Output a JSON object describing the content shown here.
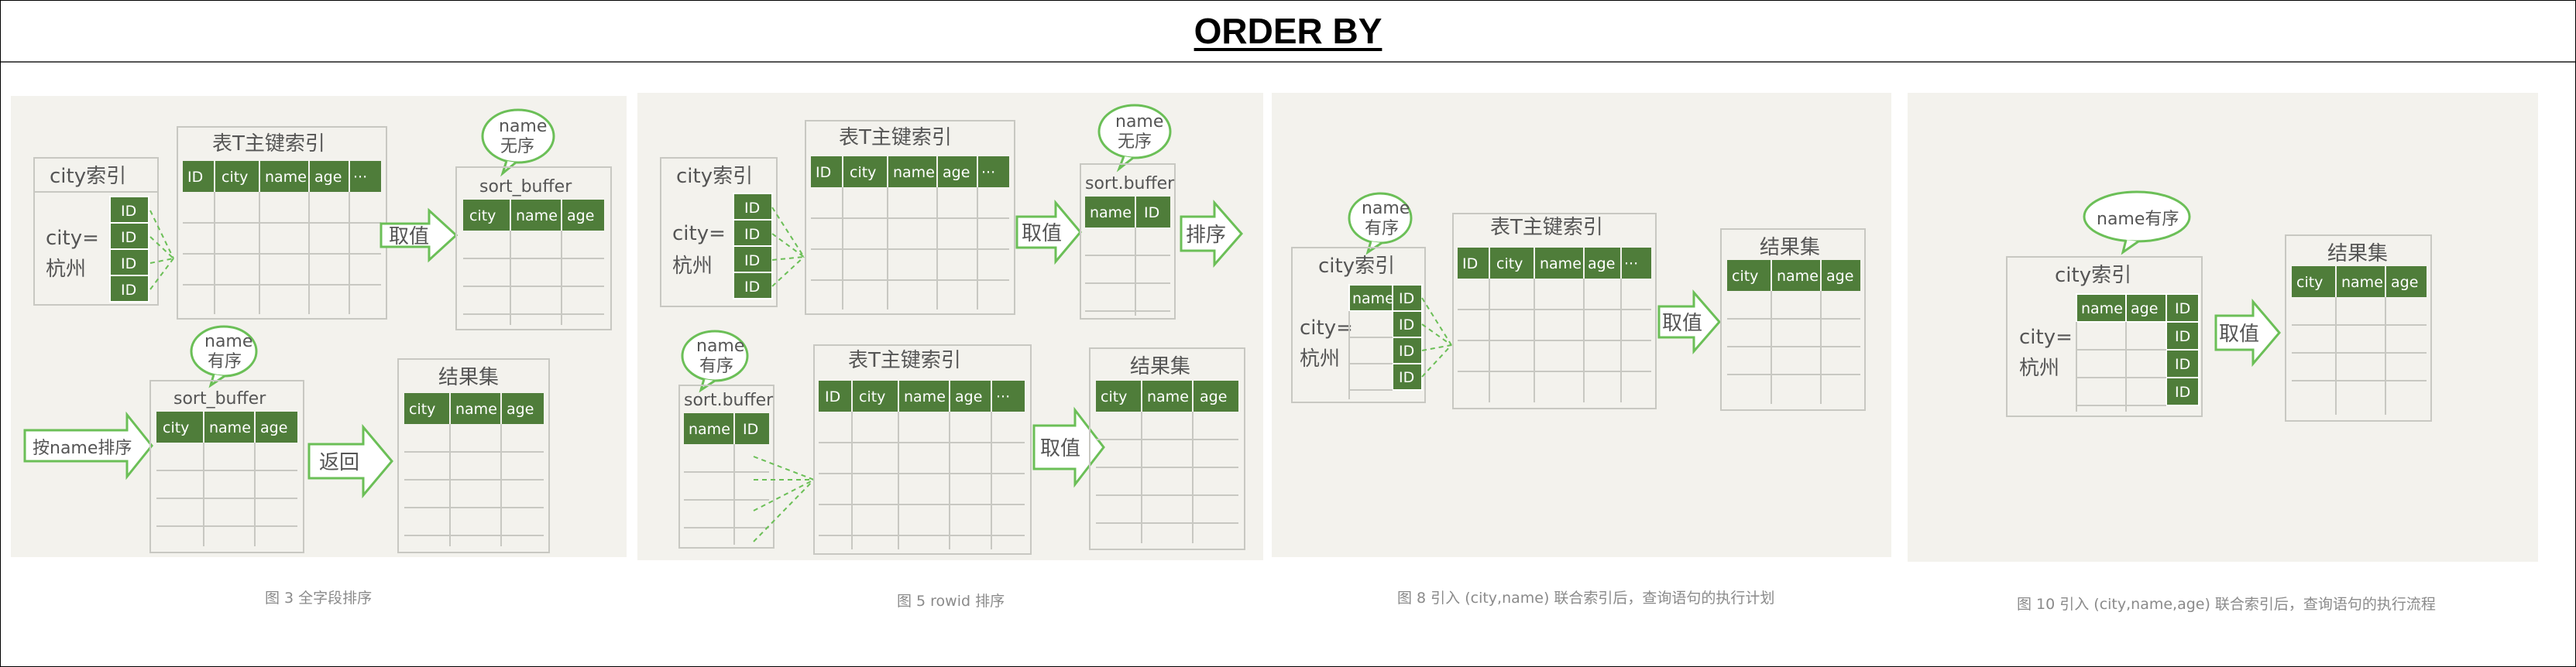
{
  "page": {
    "title": "ORDER BY"
  },
  "labels": {
    "city_index": "city索引",
    "pk_index": "表T主键索引",
    "sort_buffer": "sort_buffer",
    "sort_buffer_alt": "sort.buffer",
    "result_set": "结果集",
    "name_unsorted_1": "name",
    "name_unsorted_2": "无序",
    "name_sorted_1": "name",
    "name_sorted_2": "有序",
    "name_sorted_inline": "name有序",
    "city_eq_1": "city=",
    "city_eq_2": "杭州",
    "fetch": "取值",
    "sort": "排序",
    "sort_by_name": "按name排序",
    "return": "返回",
    "id": "ID",
    "city": "city",
    "name": "name",
    "age": "age",
    "ellipsis": "···"
  },
  "figures": [
    {
      "caption": "图 3 全字段排序"
    },
    {
      "caption": "图 5 rowid 排序"
    },
    {
      "caption": "图 8 引入 (city,name) 联合索引后，查询语句的执行计划"
    },
    {
      "caption": "图 10 引入 (city,name,age) 联合索引后，查询语句的执行流程"
    }
  ],
  "colors": {
    "panel_bg": "#f3f2ed",
    "header_green": "#4f7d3a",
    "grid_line": "#c8c8c2",
    "arrow_green": "#6bbf57",
    "text_gray": "#555555"
  }
}
